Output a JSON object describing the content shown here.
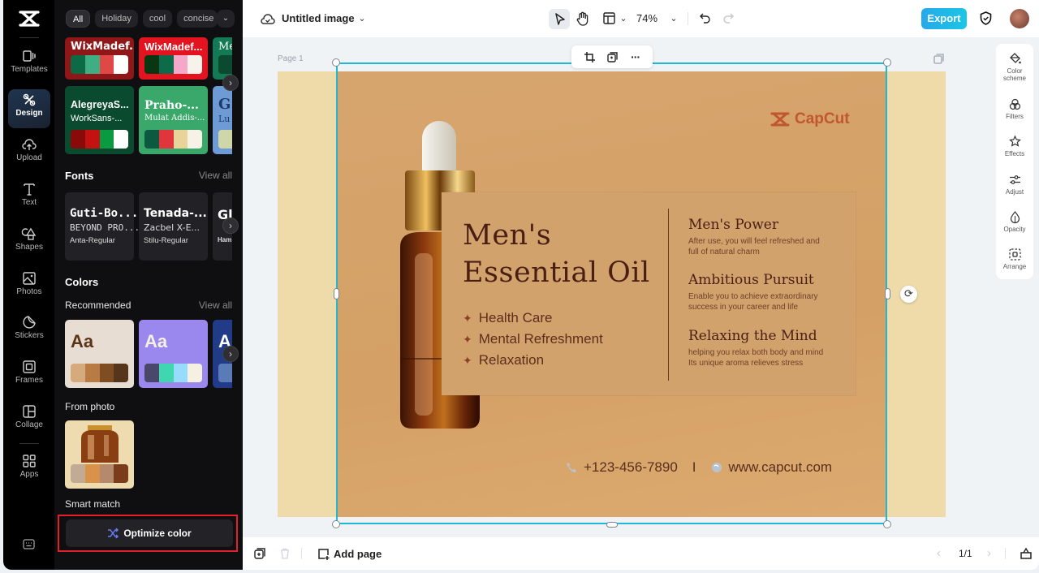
{
  "app": {
    "logo": "capcut-logo"
  },
  "nav": {
    "items": [
      {
        "label": "Templates",
        "icon": "templates-icon"
      },
      {
        "label": "Design",
        "icon": "design-icon",
        "active": true
      },
      {
        "label": "Upload",
        "icon": "upload-icon"
      },
      {
        "label": "Text",
        "icon": "text-icon"
      },
      {
        "label": "Shapes",
        "icon": "shapes-icon"
      },
      {
        "label": "Photos",
        "icon": "photos-icon"
      },
      {
        "label": "Stickers",
        "icon": "stickers-icon"
      },
      {
        "label": "Frames",
        "icon": "frames-icon"
      },
      {
        "label": "Collage",
        "icon": "collage-icon"
      },
      {
        "label": "Apps",
        "icon": "apps-icon"
      }
    ],
    "keyboard_icon": "keyboard-icon"
  },
  "panel": {
    "chips": [
      "All",
      "Holiday",
      "cool",
      "concise"
    ],
    "theme_cards": [
      {
        "title": "WixMadef...",
        "subtitle": "",
        "bg": "#8f1717",
        "colors": [
          "#0c6b45",
          "#3fae82",
          "#e04848",
          "#ffffff"
        ]
      },
      {
        "title": "WixMadef...",
        "subtitle": "",
        "bg": "#e3141f",
        "colors": [
          "#0a3612",
          "#0d6b4a",
          "#f6a8c8",
          "#f7f3ea"
        ]
      },
      {
        "title": "Me",
        "subtitle": "",
        "bg": "#147a55",
        "colors": [
          "#0b4a30",
          "#0b4a30",
          "#0b4a30",
          "#0b4a30"
        ]
      },
      {
        "title": "AlegreyaS...",
        "subtitle": "WorkSans-...",
        "bg": "#0a4a2e",
        "colors": [
          "#8a0a0a",
          "#c41212",
          "#0a9a40",
          "#ffffff"
        ]
      },
      {
        "title": "Praho-...",
        "subtitle": "Mulat Addis-...",
        "bg": "#3aa86a",
        "colors": [
          "#0b5a40",
          "#e0353c",
          "#e8d49a",
          "#f6f2e6"
        ]
      },
      {
        "title": "G",
        "subtitle": "Lu",
        "bg": "#6e9ad6",
        "colors": [
          "#cfd7a8",
          "#cfd7a8",
          "#cfd7a8",
          "#cfd7a8"
        ]
      }
    ],
    "fonts_title": "Fonts",
    "fonts_view_all": "View all",
    "font_cards": [
      {
        "line1": "Guti-Bo...",
        "line2": "BEYOND PRO...",
        "line3": "Anta-Regular"
      },
      {
        "line1": "Tenada-...",
        "line2": "Zacbel X-E...",
        "line3": "Stilu-Regular"
      },
      {
        "line1": "Gl",
        "line2": "",
        "line3": "Ham"
      }
    ],
    "colors_title": "Colors",
    "recommended_title": "Recommended",
    "recommended_view_all": "View all",
    "recommended_cards": [
      {
        "label": "Aa",
        "bg": "#e8ddd2",
        "text_color": "#5a3418",
        "colors": [
          "#d5ab7e",
          "#b77b43",
          "#7f4d22",
          "#55361a"
        ]
      },
      {
        "label": "Aa",
        "bg": "#9a88ee",
        "text_color": "#f5f0e0",
        "colors": [
          "#49476a",
          "#3fd6b0",
          "#98dcfc",
          "#f5f0e2"
        ]
      },
      {
        "label": "A",
        "bg": "#223b88",
        "text_color": "#ffffff",
        "colors": [
          "#5a7ab8",
          "#5a7ab8",
          "#5a7ab8",
          "#5a7ab8"
        ]
      }
    ],
    "from_photo_title": "From photo",
    "from_photo_colors": [
      "#c1ab94",
      "#d8924a",
      "#b58a6c",
      "#7b3c1c"
    ],
    "smart_match_title": "Smart match",
    "optimize_label": "Optimize color"
  },
  "topbar": {
    "title": "Untitled image",
    "zoom": "74%",
    "export_label": "Export"
  },
  "canvas": {
    "page_label": "Page 1",
    "poster": {
      "brand": "CapCut",
      "heading_line1": "Men's",
      "heading_line2": "Essential Oil",
      "bullets": [
        "Health Care",
        "Mental Refreshment",
        "Relaxation"
      ],
      "features": [
        {
          "title": "Men's Power",
          "line1": "After use, you will feel refreshed and",
          "line2": "full of natural charm"
        },
        {
          "title": "Ambitious Pursuit",
          "line1": "Enable you to achieve extraordinary",
          "line2": "success in your career and life"
        },
        {
          "title": "Relaxing the Mind",
          "line1": "helping you relax both body and mind",
          "line2": "Its unique aroma relieves stress"
        }
      ],
      "phone": "+123-456-7890",
      "separator": "I",
      "website": "www.capcut.com"
    }
  },
  "right_panel": {
    "items": [
      {
        "label1": "Color",
        "label2": "scheme"
      },
      {
        "label1": "Filters",
        "label2": ""
      },
      {
        "label1": "Effects",
        "label2": ""
      },
      {
        "label1": "Adjust",
        "label2": ""
      },
      {
        "label1": "Opacity",
        "label2": ""
      },
      {
        "label1": "Arrange",
        "label2": ""
      }
    ]
  },
  "bottombar": {
    "add_page_label": "Add page",
    "pager": "1/1"
  },
  "colors": {
    "accent": "#1fb7d3",
    "export": "#1bb4e8",
    "highlight_border": "#e0202a"
  }
}
